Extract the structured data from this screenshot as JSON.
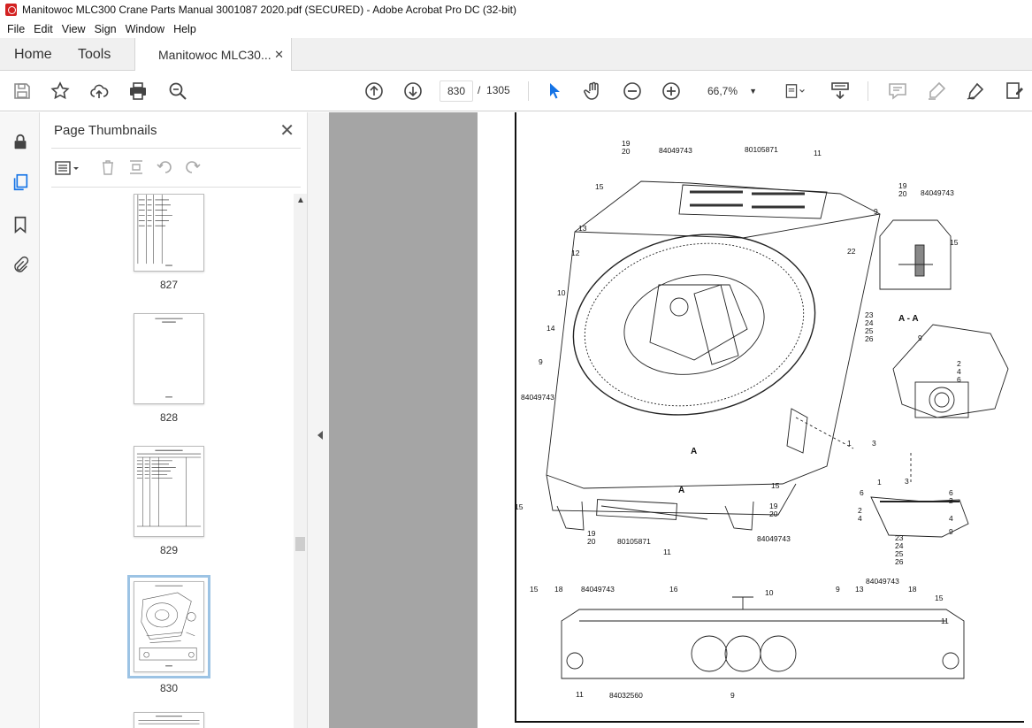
{
  "window": {
    "title": "Manitowoc MLC300 Crane Parts Manual 3001087 2020.pdf (SECURED) - Adobe Acrobat Pro DC (32-bit)"
  },
  "menu": [
    "File",
    "Edit",
    "View",
    "Sign",
    "Window",
    "Help"
  ],
  "tabs": {
    "home": "Home",
    "tools": "Tools",
    "document": "Manitowoc MLC30..."
  },
  "toolbar": {
    "current_page": "830",
    "page_separator": "/",
    "total_pages": "1305",
    "zoom": "66,7%"
  },
  "panel": {
    "title": "Page Thumbnails",
    "thumbnails": [
      {
        "label": "827"
      },
      {
        "label": "828"
      },
      {
        "label": "829"
      },
      {
        "label": "830"
      }
    ]
  },
  "drawing": {
    "section_label": "A - A",
    "callouts_top": [
      "19",
      "20",
      "84049743",
      "80105871",
      "11",
      "15",
      "13",
      "12",
      "10",
      "14",
      "9",
      "84049743"
    ],
    "callouts_detail": [
      "19",
      "20",
      "84049743",
      "9",
      "15",
      "22"
    ],
    "callouts_mid": [
      "23",
      "24",
      "25",
      "26",
      "9",
      "2",
      "4",
      "6",
      "1",
      "3"
    ],
    "callouts_bottom_left": [
      "15",
      "19",
      "20",
      "80105871",
      "11",
      "84049743",
      "15",
      "19",
      "20",
      "A",
      "A"
    ],
    "callouts_lower_detail": [
      "6",
      "1",
      "3",
      "6",
      "2",
      "2",
      "4",
      "4",
      "9",
      "23",
      "24",
      "25",
      "26"
    ],
    "callouts_side": [
      "15",
      "18",
      "84049743",
      "16",
      "10",
      "9",
      "13",
      "84049743",
      "18",
      "15",
      "11",
      "11",
      "84032560",
      "9"
    ]
  },
  "colors": {
    "accent_blue": "#1473e6",
    "document_bg": "#a5a5a5",
    "panel_selected": "#9cc3e4"
  }
}
